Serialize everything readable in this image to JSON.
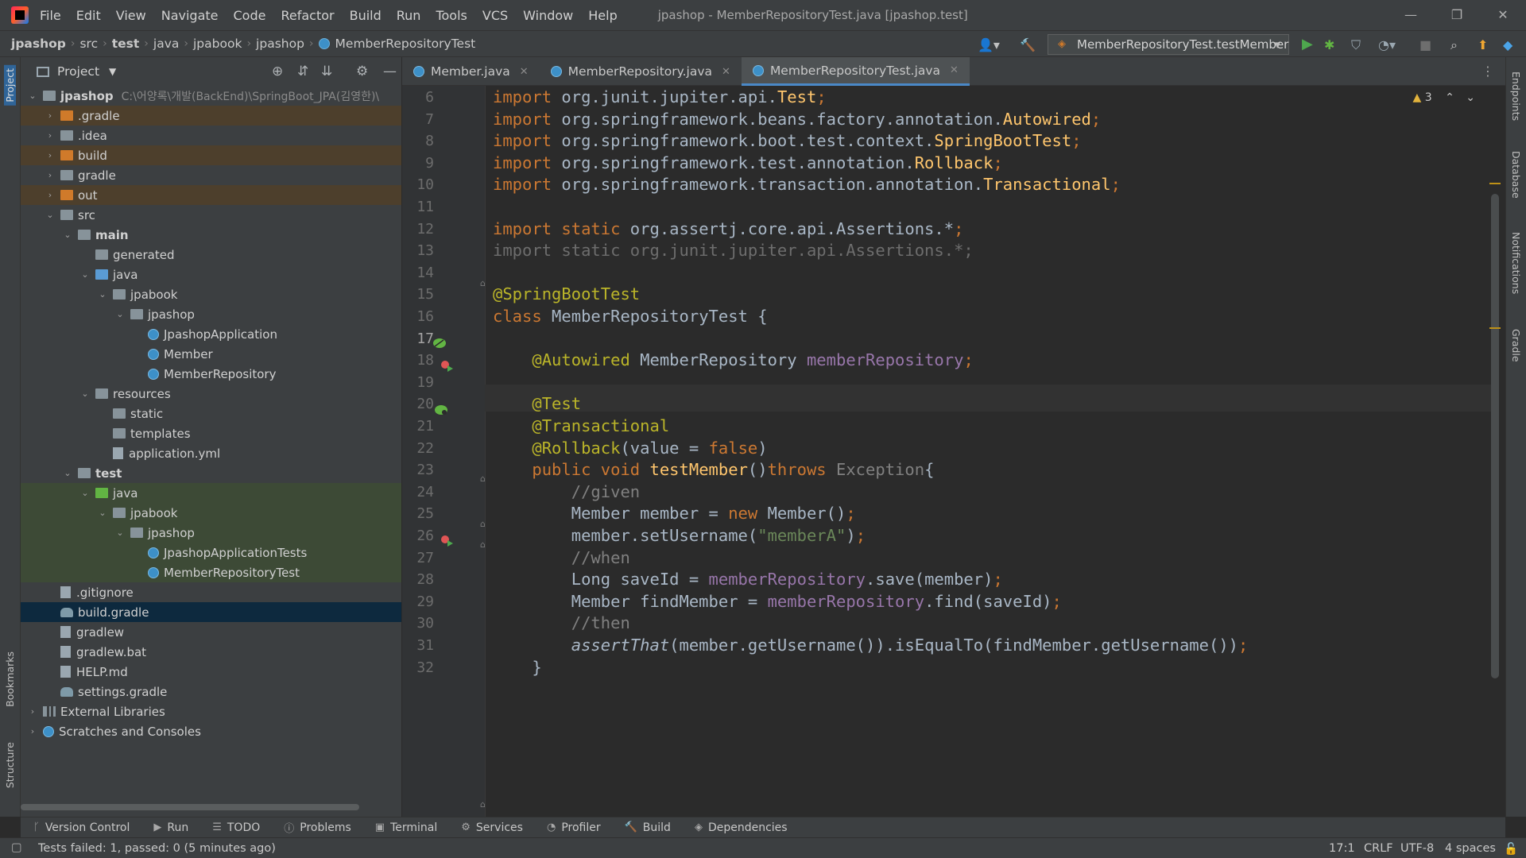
{
  "titlebar": {
    "menu": [
      "File",
      "Edit",
      "View",
      "Navigate",
      "Code",
      "Refactor",
      "Build",
      "Run",
      "Tools",
      "VCS",
      "Window",
      "Help"
    ],
    "title": "jpashop - MemberRepositoryTest.java [jpashop.test]"
  },
  "navbar": {
    "crumbs": [
      "jpashop",
      "src",
      "test",
      "java",
      "jpabook",
      "jpashop",
      "MemberRepositoryTest"
    ],
    "run_config": "MemberRepositoryTest.testMember"
  },
  "left_strip": {
    "project": "Project",
    "bookmarks": "Bookmarks",
    "structure": "Structure"
  },
  "right_strip": {
    "endpoints": "Endpoints",
    "database": "Database",
    "notifications": "Notifications",
    "gradle": "Gradle"
  },
  "project": {
    "header": "Project",
    "root_name": "jpashop",
    "root_path": "C:\\어양록\\개발(BackEnd)\\SpringBoot_JPA(김영한)\\",
    "tree": [
      {
        "label": ".gradle",
        "icon": "folder-orange",
        "arrow": "›",
        "depth": 1,
        "hl": "orange"
      },
      {
        "label": ".idea",
        "icon": "folder",
        "arrow": "›",
        "depth": 1,
        "hl": ""
      },
      {
        "label": "build",
        "icon": "folder-orange",
        "arrow": "›",
        "depth": 1,
        "hl": "orange"
      },
      {
        "label": "gradle",
        "icon": "folder",
        "arrow": "›",
        "depth": 1,
        "hl": ""
      },
      {
        "label": "out",
        "icon": "folder-orange",
        "arrow": "›",
        "depth": 1,
        "hl": "orange"
      },
      {
        "label": "src",
        "icon": "folder",
        "arrow": "⌄",
        "depth": 1,
        "hl": ""
      },
      {
        "label": "main",
        "icon": "folder",
        "arrow": "⌄",
        "depth": 2,
        "hl": "",
        "bold": true
      },
      {
        "label": "generated",
        "icon": "folder",
        "arrow": "",
        "depth": 3,
        "hl": ""
      },
      {
        "label": "java",
        "icon": "folder-blue",
        "arrow": "⌄",
        "depth": 3,
        "hl": ""
      },
      {
        "label": "jpabook",
        "icon": "folder",
        "arrow": "⌄",
        "depth": 4,
        "hl": ""
      },
      {
        "label": "jpashop",
        "icon": "folder",
        "arrow": "⌄",
        "depth": 5,
        "hl": ""
      },
      {
        "label": "JpashopApplication",
        "icon": "class",
        "arrow": "",
        "depth": 6,
        "hl": ""
      },
      {
        "label": "Member",
        "icon": "class",
        "arrow": "",
        "depth": 6,
        "hl": ""
      },
      {
        "label": "MemberRepository",
        "icon": "class",
        "arrow": "",
        "depth": 6,
        "hl": ""
      },
      {
        "label": "resources",
        "icon": "folder",
        "arrow": "⌄",
        "depth": 3,
        "hl": ""
      },
      {
        "label": "static",
        "icon": "folder",
        "arrow": "",
        "depth": 4,
        "hl": ""
      },
      {
        "label": "templates",
        "icon": "folder",
        "arrow": "",
        "depth": 4,
        "hl": ""
      },
      {
        "label": "application.yml",
        "icon": "file",
        "arrow": "",
        "depth": 4,
        "hl": ""
      },
      {
        "label": "test",
        "icon": "folder",
        "arrow": "⌄",
        "depth": 2,
        "hl": "",
        "bold": true
      },
      {
        "label": "java",
        "icon": "folder-green",
        "arrow": "⌄",
        "depth": 3,
        "hl": "green"
      },
      {
        "label": "jpabook",
        "icon": "folder",
        "arrow": "⌄",
        "depth": 4,
        "hl": "green"
      },
      {
        "label": "jpashop",
        "icon": "folder",
        "arrow": "⌄",
        "depth": 5,
        "hl": "green"
      },
      {
        "label": "JpashopApplicationTests",
        "icon": "class",
        "arrow": "",
        "depth": 6,
        "hl": "green"
      },
      {
        "label": "MemberRepositoryTest",
        "icon": "class",
        "arrow": "",
        "depth": 6,
        "hl": "green"
      },
      {
        "label": ".gitignore",
        "icon": "file",
        "arrow": "",
        "depth": 1,
        "hl": ""
      },
      {
        "label": "build.gradle",
        "icon": "gradle",
        "arrow": "",
        "depth": 1,
        "hl": "sel"
      },
      {
        "label": "gradlew",
        "icon": "file",
        "arrow": "",
        "depth": 1,
        "hl": ""
      },
      {
        "label": "gradlew.bat",
        "icon": "file",
        "arrow": "",
        "depth": 1,
        "hl": ""
      },
      {
        "label": "HELP.md",
        "icon": "file",
        "arrow": "",
        "depth": 1,
        "hl": ""
      },
      {
        "label": "settings.gradle",
        "icon": "gradle",
        "arrow": "",
        "depth": 1,
        "hl": ""
      },
      {
        "label": "External Libraries",
        "icon": "lib",
        "arrow": "›",
        "depth": 0,
        "hl": ""
      },
      {
        "label": "Scratches and Consoles",
        "icon": "scratch",
        "arrow": "›",
        "depth": 0,
        "hl": ""
      }
    ]
  },
  "tabs": [
    {
      "label": "Member.java",
      "active": false
    },
    {
      "label": "MemberRepository.java",
      "active": false
    },
    {
      "label": "MemberRepositoryTest.java",
      "active": true
    }
  ],
  "editor": {
    "warnings": "3",
    "current_line": "17",
    "lines": [
      {
        "n": "6",
        "html": "<span class='kw'>import</span> org.junit.jupiter.api.<span class='cl'>Test</span><span class='kw'>;</span>"
      },
      {
        "n": "7",
        "html": "<span class='kw'>import</span> org.springframework.beans.factory.annotation.<span class='cl'>Autowired</span><span class='kw'>;</span>"
      },
      {
        "n": "8",
        "html": "<span class='kw'>import</span> org.springframework.boot.test.context.<span class='cl'>SpringBootTest</span><span class='kw'>;</span>"
      },
      {
        "n": "9",
        "html": "<span class='kw'>import</span> org.springframework.test.annotation.<span class='cl'>Rollback</span><span class='kw'>;</span>"
      },
      {
        "n": "10",
        "html": "<span class='kw'>import</span> org.springframework.transaction.annotation.<span class='cl'>Transactional</span><span class='kw'>;</span>"
      },
      {
        "n": "11",
        "html": ""
      },
      {
        "n": "12",
        "html": "<span class='kw'>import static</span> org.assertj.core.api.Assertions.*<span class='kw'>;</span>"
      },
      {
        "n": "13",
        "html": "<span class='dim'>import static org.junit.jupiter.api.Assertions.*;</span>"
      },
      {
        "n": "14",
        "html": ""
      },
      {
        "n": "15",
        "html": "<span class='an'>@SpringBootTest</span>"
      },
      {
        "n": "16",
        "html": "<span class='kw'>class</span> MemberRepositoryTest {"
      },
      {
        "n": "17",
        "html": ""
      },
      {
        "n": "18",
        "html": "    <span class='an'>@Autowired</span> MemberRepository <span class='fd'>memberRepository</span><span class='kw'>;</span>"
      },
      {
        "n": "19",
        "html": ""
      },
      {
        "n": "20",
        "html": "    <span class='an'>@Test</span>"
      },
      {
        "n": "21",
        "html": "    <span class='an'>@Transactional</span>"
      },
      {
        "n": "22",
        "html": "    <span class='an'>@Rollback</span>(value = <span class='kw'>false</span>)"
      },
      {
        "n": "23",
        "html": "    <span class='kw'>public void</span> <span class='fn'>testMember</span>()<span class='kw'>throws</span> <span class='gr'>Exception</span>{"
      },
      {
        "n": "24",
        "html": "        <span class='cm'>//given</span>"
      },
      {
        "n": "25",
        "html": "        Member member = <span class='kw'>new</span> Member()<span class='kw'>;</span>"
      },
      {
        "n": "26",
        "html": "        member.setUsername(<span class='st'>\"memberA\"</span>)<span class='kw'>;</span>"
      },
      {
        "n": "27",
        "html": "        <span class='cm'>//when</span>"
      },
      {
        "n": "28",
        "html": "        Long saveId = <span class='fd'>memberRepository</span>.save(member)<span class='kw'>;</span>"
      },
      {
        "n": "29",
        "html": "        Member findMember = <span class='fd'>memberRepository</span>.find(saveId)<span class='kw'>;</span>"
      },
      {
        "n": "30",
        "html": "        <span class='cm'>//then</span>"
      },
      {
        "n": "31",
        "html": "        <span class='it'>assertThat</span>(member.getUsername()).isEqualTo(findMember.getUsername())<span class='kw'>;</span>"
      },
      {
        "n": "32",
        "html": "    }"
      }
    ]
  },
  "toolwindows": [
    "Version Control",
    "Run",
    "TODO",
    "Problems",
    "Terminal",
    "Services",
    "Profiler",
    "Build",
    "Dependencies"
  ],
  "status": {
    "message": "Tests failed: 1, passed: 0 (5 minutes ago)",
    "position": "17:1",
    "line_sep": "CRLF",
    "encoding": "UTF-8",
    "indent": "4 spaces"
  }
}
